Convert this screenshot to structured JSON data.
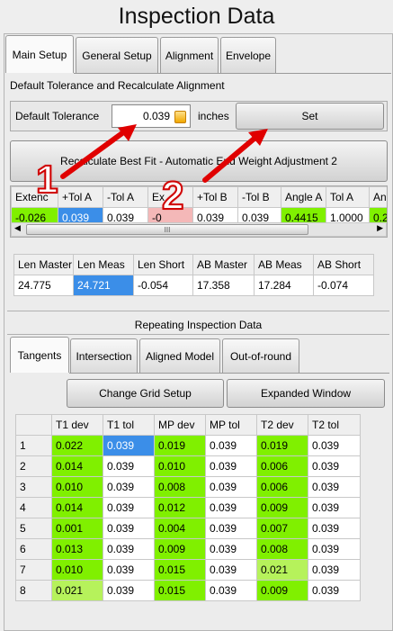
{
  "window_title": "Inspection Data",
  "main_tabs": [
    "Main Setup",
    "General Setup",
    "Alignment",
    "Envelope"
  ],
  "section_label": "Default Tolerance and Recalculate Alignment",
  "tolerance": {
    "label": "Default Tolerance",
    "value": "0.039",
    "unit": "inches",
    "set_label": "Set"
  },
  "recalc_label": "Recalculate Best Fit - Automatic End Weight Adjustment 2",
  "grid1": {
    "headers": [
      "Extenc",
      "+Tol A",
      "-Tol A",
      "Ex",
      "+Tol B",
      "-Tol B",
      "Angle A",
      "Tol A",
      "An"
    ],
    "row": [
      "-0.026",
      "0.039",
      "0.039",
      "-0",
      "0.039",
      "0.039",
      "0.4415",
      "1.0000",
      "0.2"
    ]
  },
  "scroll_mid": "III",
  "grid2": {
    "headers": [
      "Len Master",
      "Len Meas",
      "Len Short",
      "AB Master",
      "AB Meas",
      "AB Short"
    ],
    "row": [
      "24.775",
      "24.721",
      "-0.054",
      "17.358",
      "17.284",
      "-0.074"
    ]
  },
  "repeating_title": "Repeating Inspection Data",
  "sub_tabs": [
    "Tangents",
    "Intersection",
    "Aligned Model",
    "Out-of-round"
  ],
  "change_grid_label": "Change Grid Setup",
  "expanded_label": "Expanded Window",
  "tangent_table": {
    "headers": [
      "",
      "T1 dev",
      "T1 tol",
      "MP dev",
      "MP tol",
      "T2 dev",
      "T2 tol"
    ],
    "rows": [
      [
        "1",
        "0.022",
        "0.039",
        "0.019",
        "0.039",
        "0.019",
        "0.039"
      ],
      [
        "2",
        "0.014",
        "0.039",
        "0.010",
        "0.039",
        "0.006",
        "0.039"
      ],
      [
        "3",
        "0.010",
        "0.039",
        "0.008",
        "0.039",
        "0.006",
        "0.039"
      ],
      [
        "4",
        "0.014",
        "0.039",
        "0.012",
        "0.039",
        "0.009",
        "0.039"
      ],
      [
        "5",
        "0.001",
        "0.039",
        "0.004",
        "0.039",
        "0.007",
        "0.039"
      ],
      [
        "6",
        "0.013",
        "0.039",
        "0.009",
        "0.039",
        "0.008",
        "0.039"
      ],
      [
        "7",
        "0.010",
        "0.039",
        "0.015",
        "0.039",
        "0.021",
        "0.039"
      ],
      [
        "8",
        "0.021",
        "0.039",
        "0.015",
        "0.039",
        "0.009",
        "0.039"
      ]
    ]
  },
  "markers": [
    "1",
    "2"
  ],
  "colors": {
    "accent_green": "#80f000",
    "light_green": "#b6f25b",
    "selection_blue": "#3b8ee8",
    "warning_pink": "#f4b8b8",
    "arrow_red": "#e00000"
  }
}
